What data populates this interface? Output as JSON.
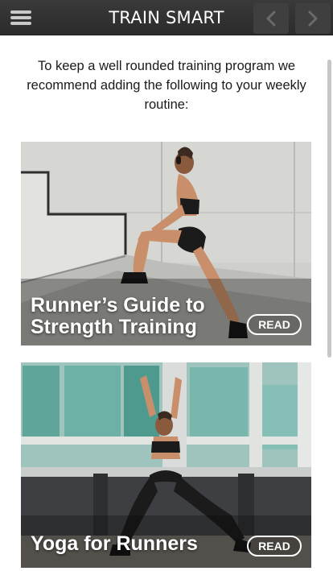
{
  "header": {
    "title": "TRAIN SMART",
    "menu_icon": "hamburger-menu-icon",
    "prev_icon": "chevron-left-icon",
    "next_icon": "chevron-right-icon"
  },
  "intro": {
    "text": "To keep a well rounded training program we recommend adding the following to your weekly routine:"
  },
  "articles": [
    {
      "title": "Runner’s Guide to Strength Training",
      "button": "READ"
    },
    {
      "title": "Yoga for Runners",
      "button": "READ"
    }
  ],
  "colors": {
    "header_bg": "#2f2f2f",
    "header_text": "#ffffff",
    "page_bg": "#ffffff",
    "body_text": "#1a1a1a"
  }
}
